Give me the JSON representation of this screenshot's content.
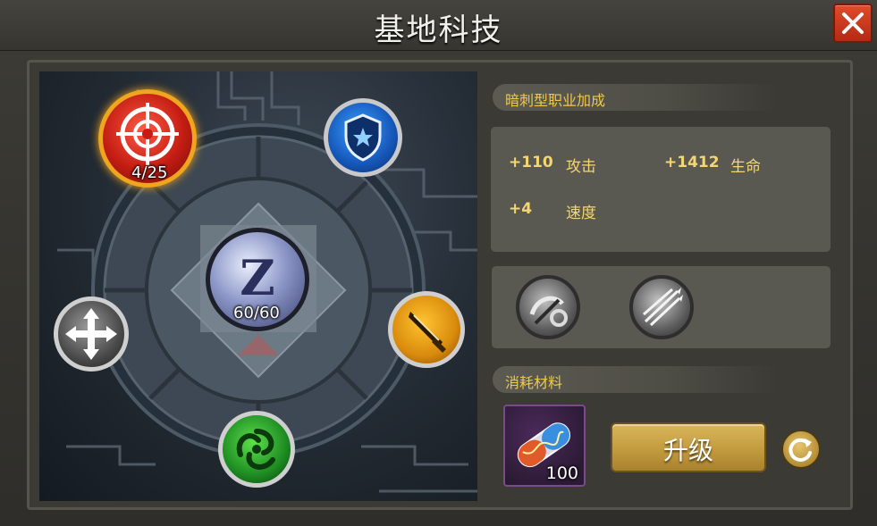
{
  "window": {
    "title": "基地科技"
  },
  "tree": {
    "nodes": [
      {
        "name": "target",
        "icon": "crosshair-icon",
        "label": "4/25",
        "selected": true
      },
      {
        "name": "shield",
        "icon": "shield-star-icon",
        "label": ""
      },
      {
        "name": "core",
        "icon": "z-emblem-icon",
        "label": "60/60"
      },
      {
        "name": "move",
        "icon": "four-arrows-icon",
        "label": ""
      },
      {
        "name": "blade",
        "icon": "knife-icon",
        "label": ""
      },
      {
        "name": "swirl",
        "icon": "green-swirl-icon",
        "label": ""
      }
    ]
  },
  "bonus": {
    "header": "暗刺型职业加成",
    "stats": [
      {
        "value": "+110",
        "name": "攻击"
      },
      {
        "value": "+1412",
        "name": "生命"
      },
      {
        "value": "+4",
        "name": "速度"
      }
    ],
    "passive_icons": [
      "chain-strike-icon",
      "arrow-volley-icon"
    ]
  },
  "materials": {
    "header": "消耗材料",
    "item": {
      "icon": "dna-capsule-icon",
      "count": "100"
    }
  },
  "actions": {
    "upgrade_label": "升级",
    "refresh_icon": "refresh-icon",
    "close_icon": "close-icon"
  },
  "colors": {
    "accent_gold": "#f0c84a",
    "close_red": "#d13c1f",
    "button_gold": "#c9a247"
  }
}
